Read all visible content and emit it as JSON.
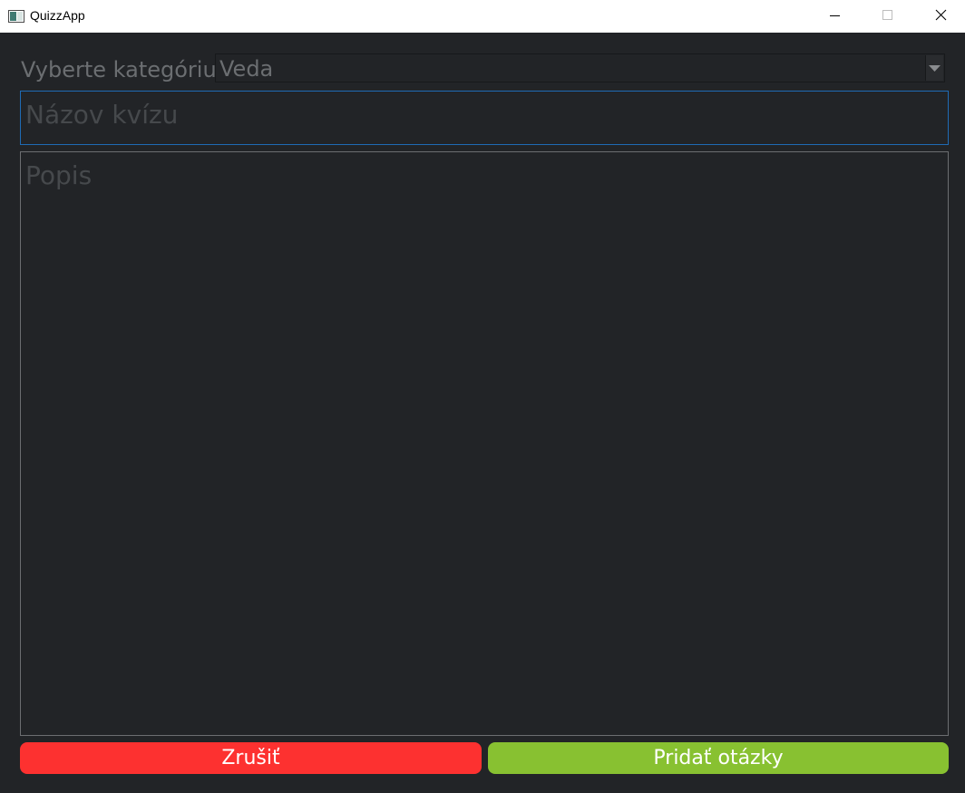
{
  "window": {
    "title": "QuizzApp"
  },
  "form": {
    "category_label": "Vyberte kategóriu:",
    "category_selected": "Veda",
    "name_placeholder": "Názov kvízu",
    "description_placeholder": "Popis"
  },
  "actions": {
    "cancel_label": "Zrušiť",
    "add_questions_label": "Pridať otázky"
  },
  "colors": {
    "background": "#222427",
    "cancel": "#fd3130",
    "add": "#88c131",
    "focus_border": "#1f6bb5"
  },
  "icons": {
    "app": "app-window-icon",
    "minimize": "minimize-icon",
    "maximize": "maximize-icon",
    "close": "close-icon",
    "dropdown": "chevron-down-icon"
  }
}
